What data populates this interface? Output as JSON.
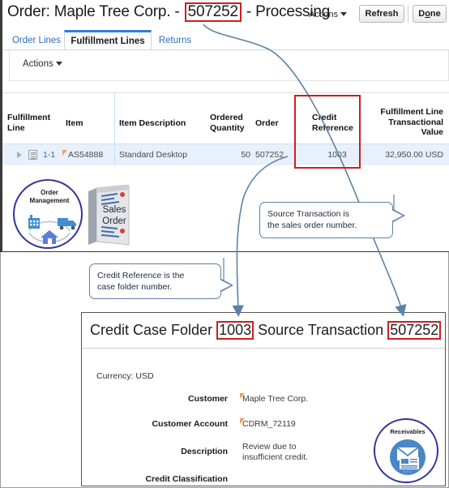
{
  "header": {
    "title_prefix": "Order: Maple Tree Corp. - ",
    "order_number": "507252",
    "title_suffix": " - Processing",
    "actions_label": "Actions",
    "refresh_label": "Refresh",
    "done_label_pre": "D",
    "done_label_key": "o",
    "done_label_post": "ne"
  },
  "tabs": [
    {
      "label": "Order Lines",
      "active": false
    },
    {
      "label": "Fulfillment Lines",
      "active": true
    },
    {
      "label": "Returns",
      "active": false
    }
  ],
  "toolbar": {
    "actions_label": "Actions"
  },
  "table": {
    "columns": [
      "Fulfillment Line",
      "Item",
      "Item Description",
      "Ordered Quantity",
      "Order",
      "Credit Reference",
      "Fulfillment Line Transactional Value"
    ],
    "header_parts": {
      "fulfillment_line_1": "Fulfillment",
      "fulfillment_line_2": "Line",
      "item": "Item",
      "item_description": "Item Description",
      "ordered_quantity_1": "Ordered",
      "ordered_quantity_2": "Quantity",
      "order": "Order",
      "credit_reference_1": "Credit",
      "credit_reference_2": "Reference",
      "fltv_1": "Fulfillment Line",
      "fltv_2": "Transactional",
      "fltv_3": "Value"
    },
    "rows": [
      {
        "fulfillment_line": "1-1",
        "item": "AS54888",
        "item_description": "Standard Desktop",
        "ordered_quantity": "50",
        "order": "507252",
        "credit_reference": "1003",
        "transactional_value": "32,950.00 USD"
      }
    ]
  },
  "icons": {
    "order_management_line1": "Order",
    "order_management_line2": "Management",
    "sales_order_line1": "Sales",
    "sales_order_line2": "Order",
    "receivables_label": "Receivables"
  },
  "callouts": [
    {
      "id": "source-transaction",
      "line1": "Source Transaction is",
      "line2": "the sales order number."
    },
    {
      "id": "credit-reference",
      "line1": "Credit Reference  is the",
      "line2": "case folder number."
    }
  ],
  "credit_case_folder": {
    "title_part1": "Credit Case Folder ",
    "folder_number": "1003",
    "title_part2": " Source Transaction ",
    "source_transaction": "507252",
    "currency_line": "Currency: USD",
    "fields": [
      {
        "label": "Customer",
        "value": "Maple Tree Corp.",
        "required": true
      },
      {
        "label": "Customer Account",
        "value": "CDRM_72119",
        "required": true
      },
      {
        "label": "Description",
        "value": "Review due to insufficient credit.",
        "required": false
      },
      {
        "label": "Credit Classification",
        "value": "",
        "required": false
      }
    ]
  },
  "colors": {
    "highlight_red": "#cc1f1f",
    "tab_active_blue": "#2f7ed8",
    "link_blue": "#2a6ebb",
    "row_highlight": "#e8f1fb",
    "arrow_blue": "#5b82a8",
    "icon_circle": "#33349a",
    "required_flag": "#f0a05a"
  }
}
